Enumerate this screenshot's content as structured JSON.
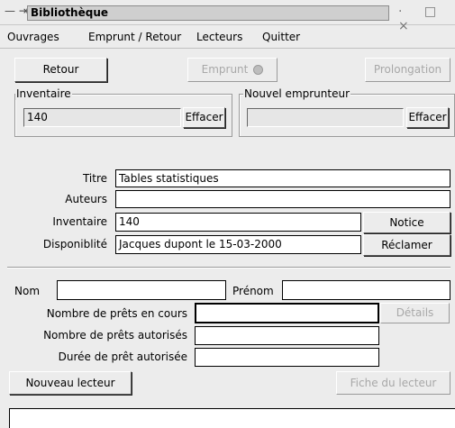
{
  "window": {
    "title": "Bibliothèque",
    "left_controls": "— ⇥",
    "right_controls": "· □ ×"
  },
  "menu": [
    "Ouvrages",
    "Emprunt / Retour",
    "Lecteurs",
    "Quitter"
  ],
  "toolbar": {
    "retour": "Retour",
    "emprunt": "Emprunt",
    "prolongation": "Prolongation"
  },
  "inventaire_group": {
    "label": "Inventaire",
    "value": "140",
    "clear": "Effacer"
  },
  "emprunteur_group": {
    "label": "Nouvel emprunteur",
    "value": "",
    "clear": "Effacer"
  },
  "ouvrage": {
    "titre_label": "Titre",
    "titre_value": "Tables statistiques",
    "auteurs_label": "Auteurs",
    "auteurs_value": "",
    "inventaire_label": "Inventaire",
    "inventaire_value": "140",
    "notice_button": "Notice",
    "dispo_label": "Disponiblité",
    "dispo_value": "Jacques dupont le 15-03-2000",
    "reclamer_button": "Réclamer"
  },
  "lecteur": {
    "nom_label": "Nom",
    "nom_value": "",
    "prenom_label": "Prénom",
    "prenom_value": "",
    "prets_en_cours_label": "Nombre de prêts en cours",
    "prets_en_cours_value": "",
    "details_button": "Détails",
    "prets_autorises_label": "Nombre de prêts autorisés",
    "prets_autorises_value": "",
    "duree_label": "Durée de prêt autorisée",
    "duree_value": "",
    "nouveau_button": "Nouveau lecteur",
    "fiche_button": "Fiche du lecteur"
  },
  "status": ""
}
